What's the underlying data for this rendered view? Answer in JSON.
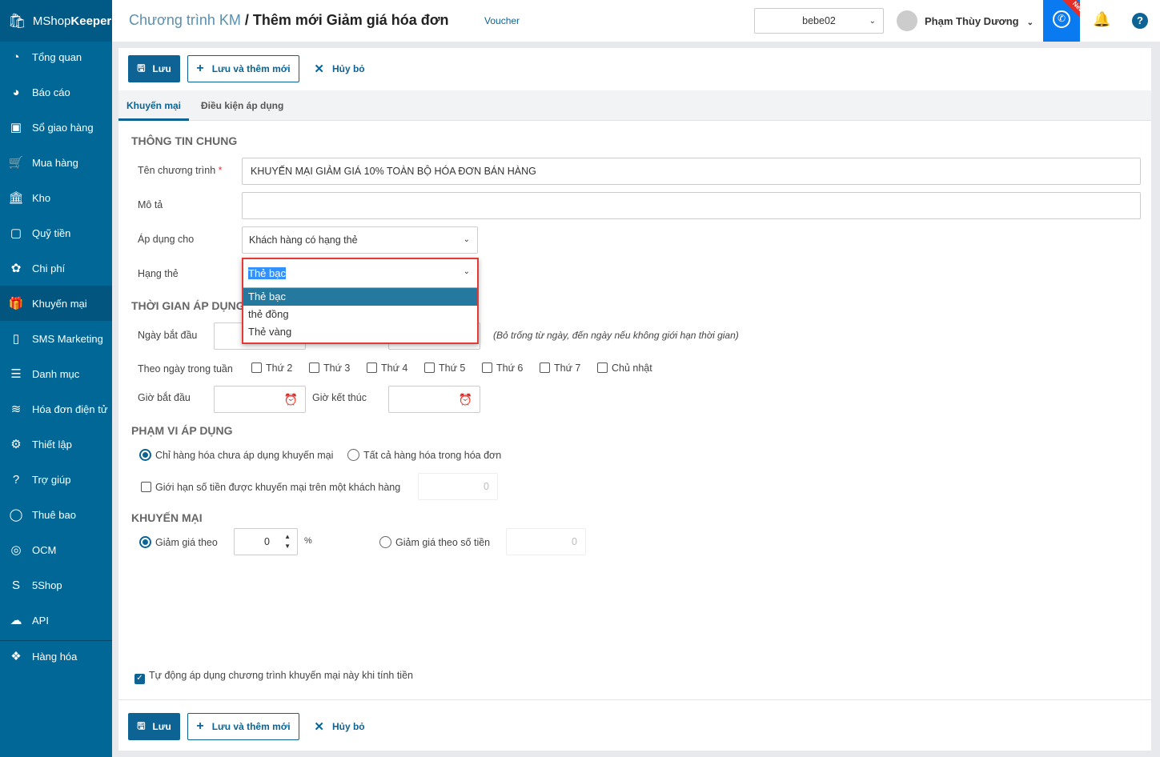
{
  "app": {
    "logo_a": "MShop",
    "logo_b": "Keeper"
  },
  "sidebar": {
    "items": [
      {
        "label": "Tổng quan",
        "icon": "dashboard-icon"
      },
      {
        "label": "Báo cáo",
        "icon": "pie-chart-icon"
      },
      {
        "label": "Sổ giao hàng",
        "icon": "delivery-book-icon"
      },
      {
        "label": "Mua hàng",
        "icon": "cart-icon"
      },
      {
        "label": "Kho",
        "icon": "warehouse-icon"
      },
      {
        "label": "Quỹ tiền",
        "icon": "safe-icon"
      },
      {
        "label": "Chi phí",
        "icon": "expense-icon"
      },
      {
        "label": "Khuyến mại",
        "icon": "gift-icon"
      },
      {
        "label": "SMS Marketing",
        "icon": "phone-icon"
      },
      {
        "label": "Danh mục",
        "icon": "list-icon"
      },
      {
        "label": "Hóa đơn điện tử",
        "icon": "invoice-icon"
      },
      {
        "label": "Thiết lập",
        "icon": "gear-icon"
      },
      {
        "label": "Trợ giúp",
        "icon": "help-icon"
      },
      {
        "label": "Thuê bao",
        "icon": "user-icon"
      },
      {
        "label": "OCM",
        "icon": "ocm-icon"
      },
      {
        "label": "5Shop",
        "icon": "5shop-icon"
      },
      {
        "label": "API",
        "icon": "cloud-upload-icon"
      },
      {
        "label": "Hàng hóa",
        "icon": "boxes-icon"
      }
    ]
  },
  "header": {
    "crumb_parent": "Chương trình KM",
    "crumb_sep": " / ",
    "crumb_current": "Thêm mới Giảm giá hóa đơn",
    "voucher": "Voucher",
    "store": "bebe02",
    "user": "Phạm Thùy Dương",
    "new_badge": "New"
  },
  "toolbar": {
    "save": "Lưu",
    "save_new": "Lưu và thêm mới",
    "cancel": "Hủy bỏ"
  },
  "tabs": [
    "Khuyến mại",
    "Điều kiện áp dụng"
  ],
  "general": {
    "title": "THÔNG TIN CHUNG",
    "name_label": "Tên chương trình",
    "required": "*",
    "name_value": "KHUYẾN MẠI GIẢM GIÁ 10% TOÀN BỘ HÓA ĐƠN BÁN HÀNG",
    "desc_label": "Mô tả",
    "desc_value": "",
    "apply_label": "Áp dụng cho",
    "apply_value": "Khách hàng có hạng thẻ",
    "tier_label": "Hạng thẻ",
    "tier_value": "Thẻ bạc",
    "tier_options": [
      "Thẻ bạc",
      "thẻ đồng",
      "Thẻ vàng"
    ]
  },
  "time": {
    "title": "THỜI GIAN ÁP DỤNG",
    "start_date_label": "Ngày bắt đầu",
    "hint": "(Bỏ trống từ ngày, đến ngày nếu không giới hạn thời gian)",
    "weekday_label": "Theo ngày trong tuần",
    "weekdays": [
      "Thứ 2",
      "Thứ 3",
      "Thứ 4",
      "Thứ 5",
      "Thứ 6",
      "Thứ 7",
      "Chủ nhật"
    ],
    "start_time_label": "Giờ bắt đầu",
    "end_time_label": "Giờ kết thúc"
  },
  "scope": {
    "title": "PHẠM VI ÁP DỤNG",
    "opt1": "Chỉ hàng hóa chưa áp dụng khuyến mại",
    "opt2": "Tất cả hàng hóa trong hóa đơn",
    "limit_label": "Giới hạn số tiền được khuyến mại trên một khách hàng",
    "limit_value": "0"
  },
  "promo": {
    "title": "KHUYẾN MẠI",
    "percent_label": "Giảm giá theo",
    "percent_value": "0",
    "percent_unit": "%",
    "amount_label": "Giảm giá theo số tiền",
    "amount_value": "0"
  },
  "auto_apply": "Tự động áp dụng chương trình khuyến mại này khi tính tiền"
}
